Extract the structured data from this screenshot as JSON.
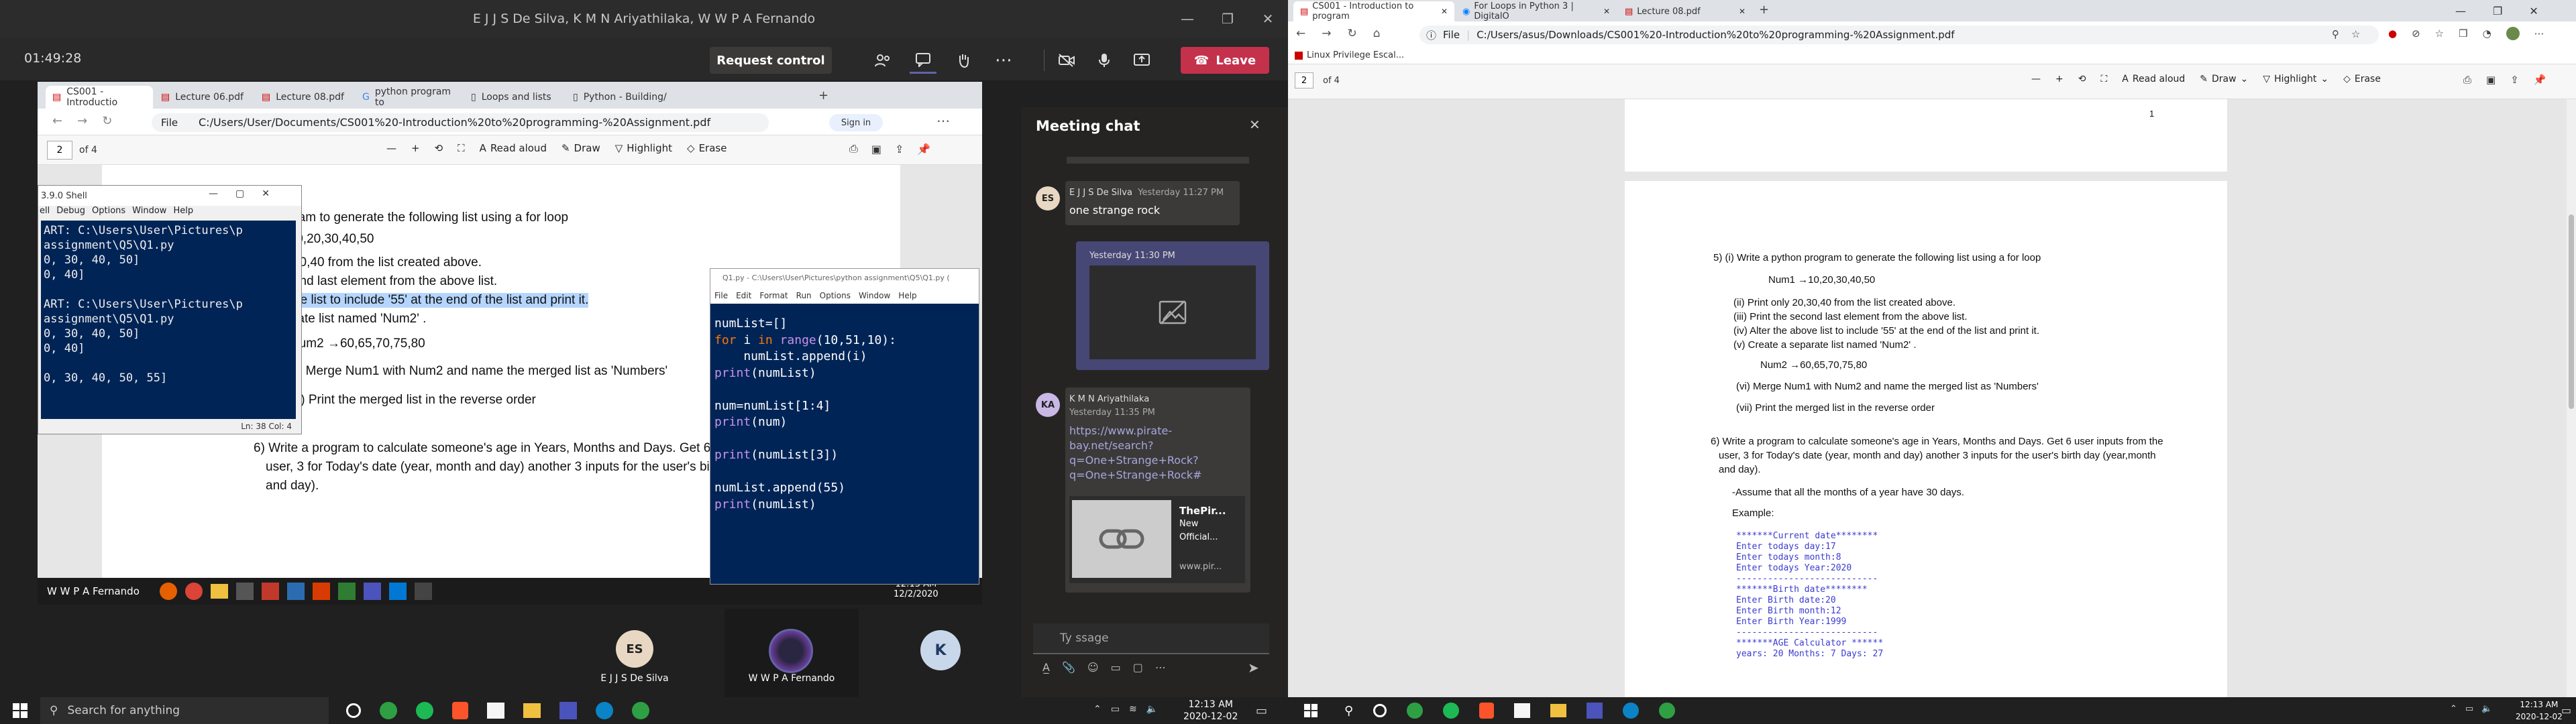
{
  "teams": {
    "window_title": "E J J S De Silva, K M N Ariyathilaka, W W P A Fernando",
    "timer": "01:49:28",
    "request_control": "Request control",
    "leave": "Leave",
    "chat": {
      "title": "Meeting chat",
      "messages": [
        {
          "initials": "ES",
          "sender": "E J J S De Silva",
          "time": "Yesterday 11:27 PM",
          "text": "one strange rock"
        },
        {
          "time": "Yesterday 11:30 PM"
        },
        {
          "initials": "KA",
          "sender": "K M N Ariyathilaka",
          "time": "Yesterday 11:35 PM",
          "link_lines": [
            "https://www.pirate-",
            "bay.net/search?",
            "q=One+Strange+Rock?",
            "q=One+Strange+Rock#"
          ],
          "preview_title_lines": [
            "ThePir...",
            "New",
            "Official..."
          ],
          "preview_domain": "www.pir..."
        }
      ],
      "compose_placeholder": "Ty        ssage"
    },
    "participants": [
      {
        "initials": "ES",
        "name": "E J J S De Silva"
      },
      {
        "name": "W W P A Fernando"
      },
      {
        "initials": "K"
      }
    ]
  },
  "shared": {
    "tabs": [
      "CS001 - Introductio",
      "Lecture 06.pdf",
      "Lecture 08.pdf",
      "python program to",
      "Loops and lists",
      "Python - Building/"
    ],
    "url": "C:/Users/User/Documents/CS001%20-Introduction%20to%20programming-%20Assignment.pdf",
    "file_label": "File",
    "signin": "Sign in",
    "page_num": "2",
    "page_of": "of 4",
    "pdf_tools": [
      "Read aloud",
      "Draw",
      "Highlight",
      "Erase"
    ],
    "doc_lines": [
      "python program to generate the following list using a for loop",
      "m1 →10,20,30,40,50",
      "nly 20,30,40 from the list created above.",
      "he second last element from the above list.",
      "he above list to include '55' at the end of the list and print it.",
      "a separate list named 'Num2' .",
      "Num2 →60,65,70,75,80",
      "(vi) Merge Num1 with Num2 and name the merged list as 'Numbers'",
      "(vii) Print the merged list in the reverse order",
      "6) Write a program to calculate someone's age in Years, Months and Days. Get 6 use",
      "user, 3 for Today's date (year, month and day) another 3 inputs for the user's birth",
      "and day)."
    ],
    "idle_title": "3.9.0 Shell",
    "idle_menu": [
      "ell",
      "Debug",
      "Options",
      "Window",
      "Help"
    ],
    "idle_output": "ART: C:\\Users\\User\\Pictures\\p\nassignment\\Q5\\Q1.py\n0, 30, 40, 50]\n0, 40]\n\nART: C:\\Users\\User\\Pictures\\p\nassignment\\Q5\\Q1.py\n0, 30, 40, 50]\n0, 40]\n\n0, 30, 40, 50, 55]",
    "idle_status": "Ln: 38  Col: 4",
    "editor_title": "Q1.py - C:\\Users\\User\\Pictures\\python assignment\\Q5\\Q1.py (",
    "editor_menu": [
      "File",
      "Edit",
      "Format",
      "Run",
      "Options",
      "Window",
      "Help"
    ],
    "user_label": "W W P A Fernando",
    "clock_time": "12:13 AM",
    "clock_date": "12/2/2020"
  },
  "taskbar_left": {
    "search": "Search for anything",
    "time": "12:13 AM",
    "date": "2020-12-02"
  },
  "taskbar_right": {
    "time": "12:13 AM",
    "date": "2020-12-02"
  },
  "edge": {
    "tabs": [
      "CS001 - Introduction to program",
      "For Loops in Python 3 | DigitalO",
      "Lecture 08.pdf"
    ],
    "file_label": "File",
    "url": "C:/Users/asus/Downloads/CS001%20-Introduction%20to%20programming-%20Assignment.pdf",
    "favorite": "Linux Privilege Escal...",
    "page_num": "2",
    "page_of": "of 4",
    "pdf_tools": [
      "Read aloud",
      "Draw",
      "Highlight",
      "Erase"
    ],
    "prev_page_number": "1",
    "q5": [
      "5)   (i) Write a python program to generate the following list using a for loop",
      "Num1 →10,20,30,40,50",
      "(ii)  Print only 20,30,40 from the list created above.",
      "(iii) Print the second last element from the above list.",
      "(iv) Alter the above list to include '55' at the end of the list and print it.",
      "(v) Create a separate list named 'Num2' .",
      "Num2 →60,65,70,75,80",
      "(vi) Merge Num1 with Num2 and name the merged list as 'Numbers'",
      "(vii) Print the merged list in the reverse order"
    ],
    "q6": [
      "6) Write a program to calculate someone's age in Years, Months and Days. Get 6 user inputs from the",
      "user, 3 for Today's date (year, month and day) another 3 inputs for the user's birth day (year,month",
      "and day).",
      "-Assume that all the months of a year have 30 days.",
      "Example:"
    ],
    "example": [
      "*******Current date********",
      "Enter todays day:17",
      "Enter todays month:8",
      "Enter todays Year:2020",
      "---------------------------",
      "*******Birth date********",
      "Enter  Birth date:20",
      "Enter Birth month:12",
      "Enter Birth Year:1999",
      "---------------------------",
      "*******AGE Calculator ******",
      "years: 20 Months: 7 Days: 27"
    ]
  }
}
